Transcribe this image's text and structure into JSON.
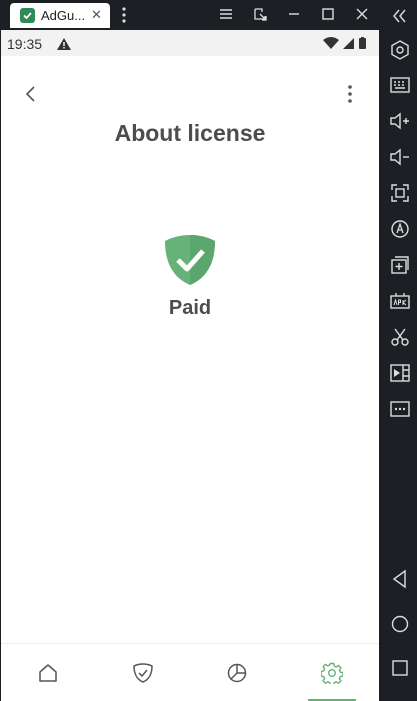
{
  "emulator": {
    "tab_title": "AdGu...",
    "tab_close_glyph": "✕",
    "tab_icon": "adguard-shield-icon",
    "window_buttons": [
      "menu-icon",
      "external-link-icon",
      "minimize-icon",
      "maximize-icon",
      "close-icon"
    ],
    "sidebar_buttons": [
      "collapse-icon",
      "settings-hexagon-icon",
      "keyboard-icon",
      "volume-up-icon",
      "volume-down-icon",
      "fullscreen-icon",
      "rotate-icon",
      "add-window-icon",
      "apk-icon",
      "scissors-icon",
      "video-icon",
      "more-icon",
      "back-triangle-icon",
      "home-circle-icon",
      "recents-square-icon"
    ]
  },
  "status_bar": {
    "time": "19:35",
    "icons": [
      "warning-icon",
      "wifi-icon",
      "signal-icon",
      "battery-icon"
    ]
  },
  "page": {
    "title": "About license",
    "license_status": "Paid"
  },
  "bottom_nav": {
    "items": [
      "home-icon",
      "protection-icon",
      "statistics-icon",
      "settings-icon"
    ],
    "active_index": 3
  },
  "colors": {
    "accent": "#67b279",
    "shield": "#67b279",
    "text": "#4d4d4d"
  }
}
